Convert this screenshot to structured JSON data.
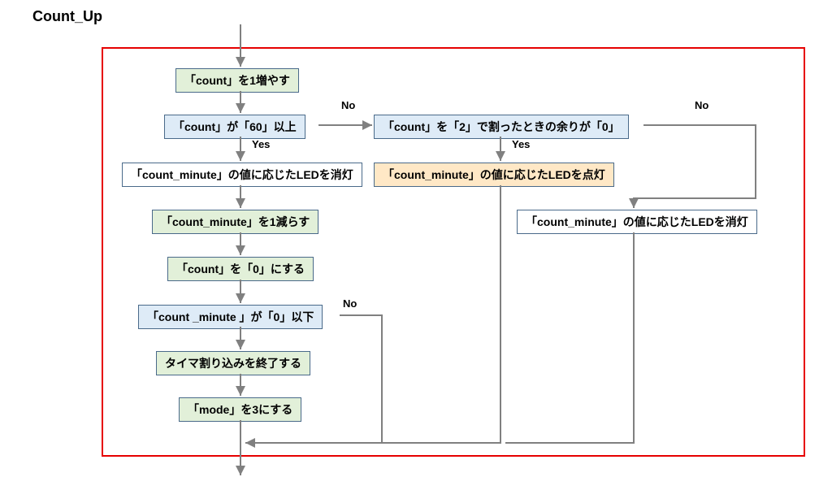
{
  "diagram": {
    "title": "Count_Up",
    "steps": {
      "s1": "「count」を1増やす",
      "s2": "「count」が「60」以上",
      "s3": "「count_minute」の値に応じたLEDを消灯",
      "s4": "「count_minute」を1減らす",
      "s5": "「count」を「0」にする",
      "s6": "「count _minute 」が「0」以下",
      "s7": "タイマ割り込みを終了する",
      "s8": "「mode」を3にする",
      "s9": "「count」を「2」で割ったときの余りが「0」",
      "s10": "「count_minute」の値に応じたLEDを点灯",
      "s11": "「count_minute」の値に応じたLEDを消灯"
    },
    "labels": {
      "yes1": "Yes",
      "no1": "No",
      "yes2": "Yes",
      "no2": "No",
      "no3": "No"
    }
  }
}
